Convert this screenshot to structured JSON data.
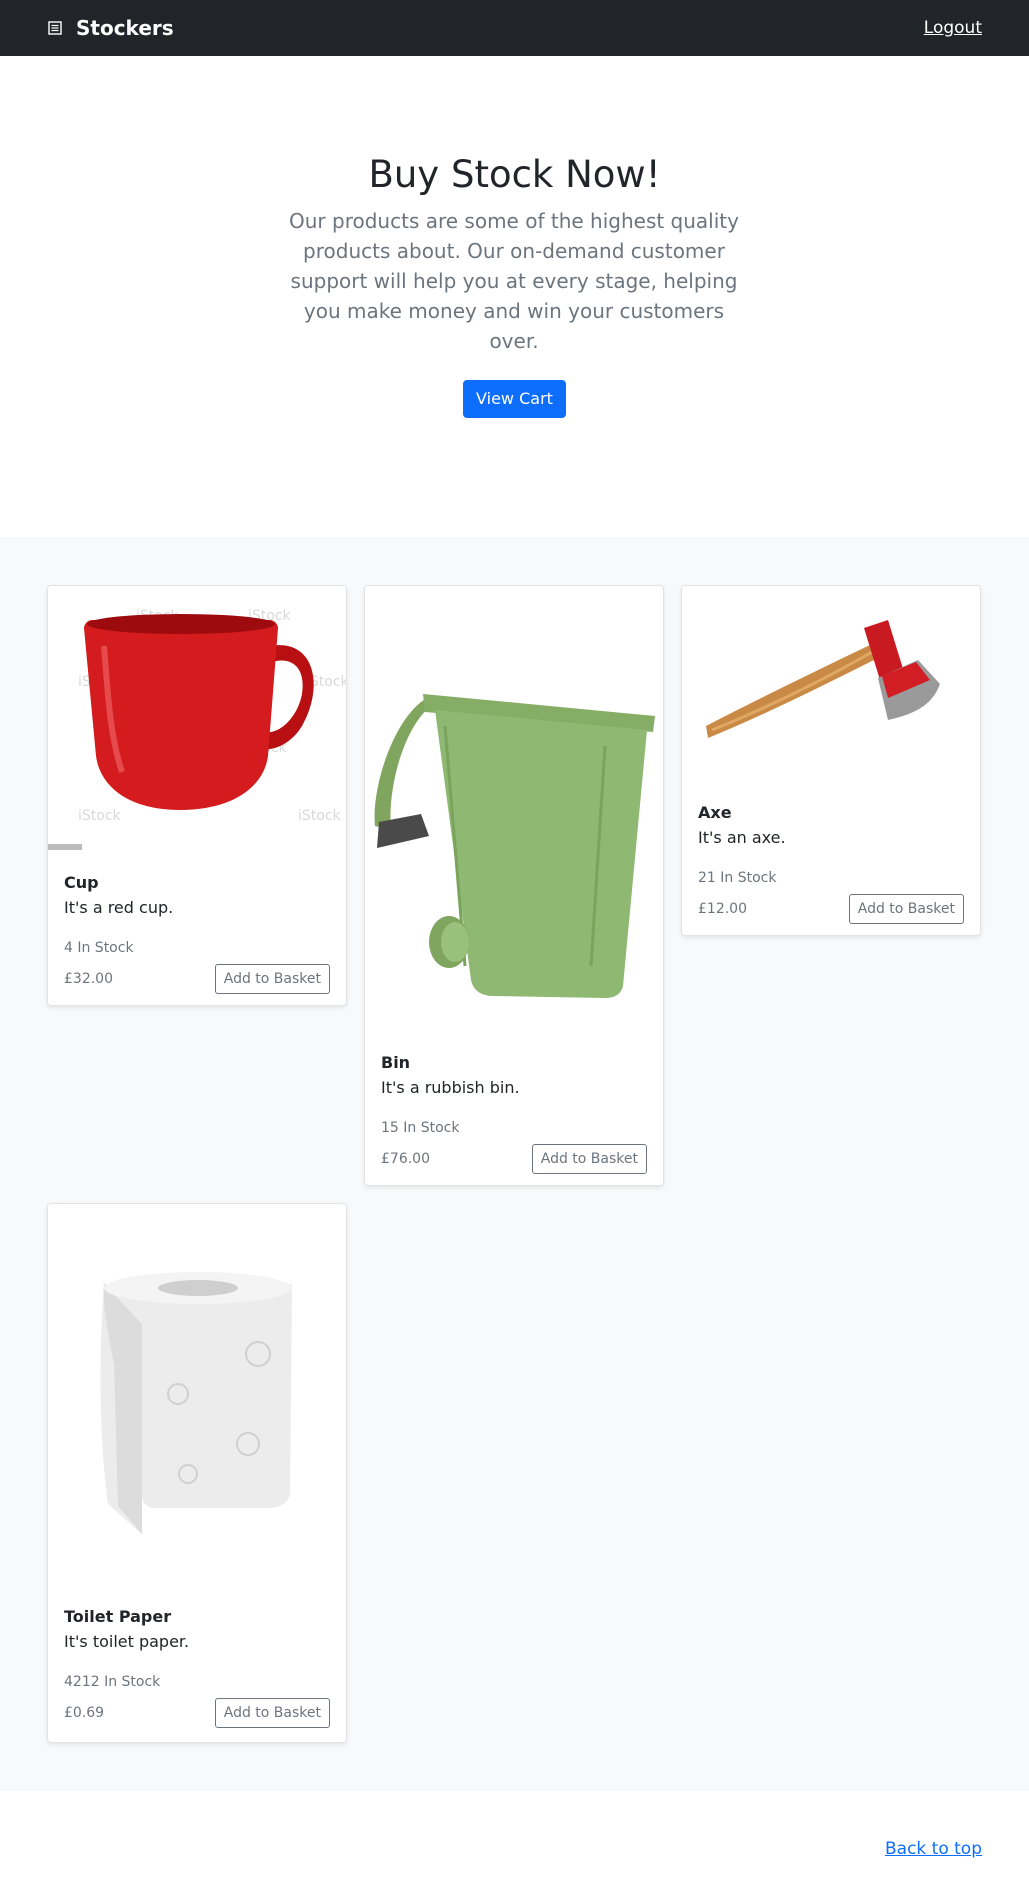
{
  "navbar": {
    "brand": "Stockers",
    "brand_icon": "list-icon",
    "logout_label": "Logout"
  },
  "hero": {
    "title": "Buy Stock Now!",
    "lead": "Our products are some of the highest quality products about. Our on-demand customer support will help you at every stage, helping you make money and win your customers over.",
    "view_cart_label": "View Cart"
  },
  "products": [
    {
      "name": "Cup",
      "description": "It's a red cup.",
      "stock": "4 In Stock",
      "price": "£32.00",
      "button_label": "Add to Basket",
      "image": "red-mug-image"
    },
    {
      "name": "Bin",
      "description": "It's a rubbish bin.",
      "stock": "15 In Stock",
      "price": "£76.00",
      "button_label": "Add to Basket",
      "image": "green-bin-image"
    },
    {
      "name": "Axe",
      "description": "It's an axe.",
      "stock": "21 In Stock",
      "price": "£12.00",
      "button_label": "Add to Basket",
      "image": "axe-image"
    },
    {
      "name": "Toilet Paper",
      "description": "It's toilet paper.",
      "stock": "4212 In Stock",
      "price": "£0.69",
      "button_label": "Add to Basket",
      "image": "toilet-paper-image"
    }
  ],
  "footer": {
    "back_to_top_label": "Back to top"
  },
  "colors": {
    "navbar_bg": "#212529",
    "primary": "#0d6efd",
    "muted": "#6c757d",
    "album_bg": "#f8f9fa"
  }
}
